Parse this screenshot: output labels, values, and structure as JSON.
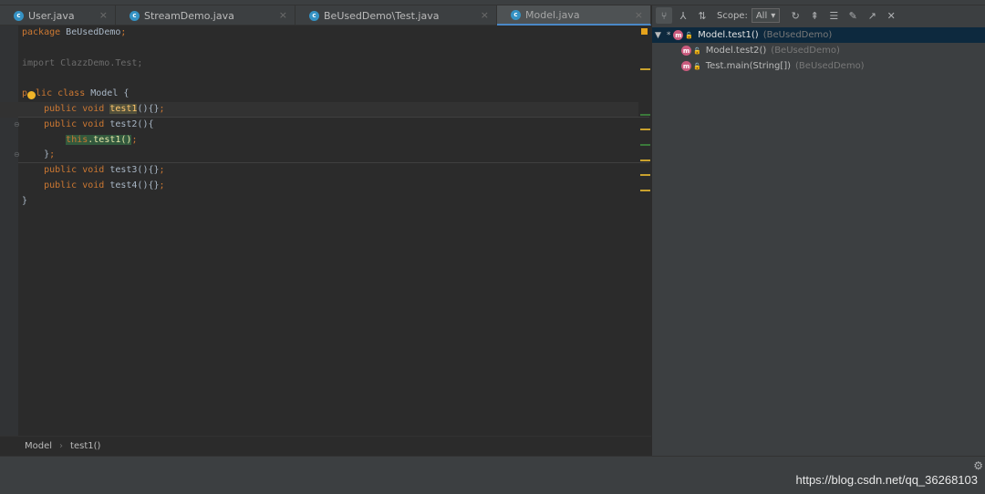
{
  "editor_tabs": [
    {
      "label": "User.java",
      "close": "×"
    },
    {
      "label": "StreamDemo.java",
      "close": "×"
    },
    {
      "label": "BeUsedDemo\\Test.java",
      "close": "×"
    },
    {
      "label": "Model.java",
      "close": "×",
      "active": true
    }
  ],
  "file_icon_letter": "c",
  "code": {
    "l1_kw": "package",
    "l1_rest": " BeUsedDemo",
    "l1_semi": ";",
    "l3": "import ClazzDemo.Test;",
    "l5_p": "p",
    "l5_rest": "lic",
    "l5_kw2": " class",
    "l5_name": " Model {",
    "l6_kw": "    public void",
    "l6_name": "test1",
    "l6_rest": "(){}",
    "l6_semi": ";",
    "l7_kw": "    public void",
    "l7_name": " test2(){",
    "l8_ind": "        ",
    "l8_this": "this",
    "l8_call": ".test1()",
    "l8_semi": ";",
    "l9_brace": "    }",
    "l9_semi": ";",
    "l10_kw": "    public void",
    "l10_name": " test3(){}",
    "l10_semi": ";",
    "l11_kw": "    public void",
    "l11_name": " test4(){}",
    "l11_semi": ";",
    "l12": "}"
  },
  "breadcrumb": {
    "class": "Model",
    "method": "test1()",
    "sep": "›"
  },
  "hierarchy": {
    "scope_label": "Scope:",
    "scope_value": "All",
    "root": {
      "expand": "▼",
      "star": "*",
      "method": "Model.test1()",
      "pkg": "(BeUsedDemo)"
    },
    "children": [
      {
        "method": "Model.test2()",
        "pkg": "(BeUsedDemo)"
      },
      {
        "method": "Test.main(String[])",
        "pkg": "(BeUsedDemo)"
      }
    ],
    "method_icon_letter": "m",
    "colors": {
      "selection": "#0d293e",
      "method_icon": "#ca5b7e"
    }
  },
  "watermark": "https://blog.csdn.net/qq_36268103",
  "colors": {
    "keyword": "#cc7832",
    "text": "#a9b7c6",
    "usage_highlight": "#52503a",
    "call_highlight": "#32593d",
    "tab_underline": "#4a88c7"
  }
}
